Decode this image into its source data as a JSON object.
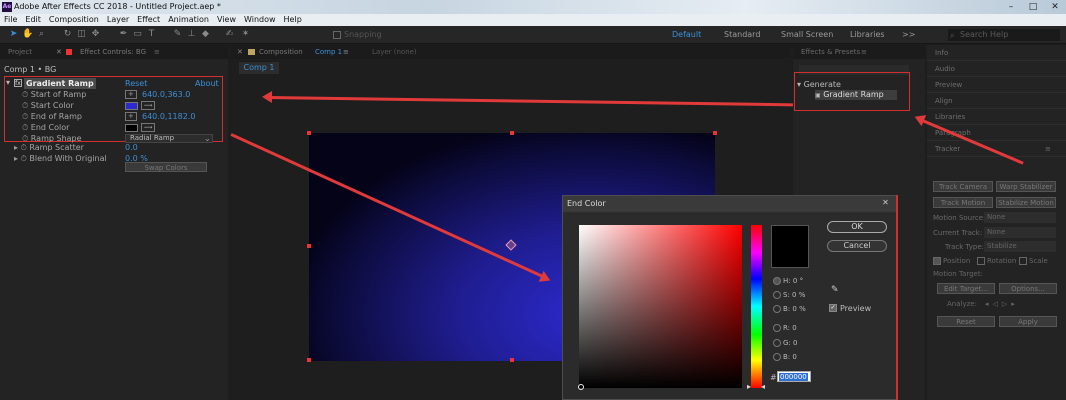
{
  "window": {
    "title": "Adobe After Effects CC 2018 - Untitled Project.aep *",
    "logo": "Ae"
  },
  "menu": [
    "File",
    "Edit",
    "Composition",
    "Layer",
    "Effect",
    "Animation",
    "View",
    "Window",
    "Help"
  ],
  "toolbar": {
    "snapping": "Snapping",
    "workspaces": [
      "Default",
      "Standard",
      "Small Screen",
      "Libraries"
    ],
    "active_workspace": "Default",
    "more": ">>",
    "search_placeholder": "Search Help"
  },
  "project_tab": "Project",
  "effect_controls": {
    "tab": "Effect Controls: BG",
    "breadcrumb": "Comp 1 • BG",
    "effect_name": "Gradient Ramp",
    "fx_badge": "fx",
    "reset": "Reset",
    "about": "About",
    "props": [
      {
        "name": "Start of Ramp",
        "value": "640.0,363.0"
      },
      {
        "name": "Start Color",
        "value": ""
      },
      {
        "name": "End of Ramp",
        "value": "640.0,1182.0"
      },
      {
        "name": "End Color",
        "value": ""
      },
      {
        "name": "Ramp Shape",
        "value": "Radial Ramp"
      },
      {
        "name": "Ramp Scatter",
        "value": "0.0"
      },
      {
        "name": "Blend With Original",
        "value": "0.0 %"
      }
    ],
    "swap_button": "Swap Colors"
  },
  "composition": {
    "tab": "Composition Comp 1",
    "tab_prefix": "Composition",
    "tab_comp": "Comp 1",
    "layer_tab": "Layer (none)",
    "comp_tab": "Comp 1"
  },
  "effects_presets": {
    "tab": "Effects & Presets",
    "category": "Generate",
    "item": "Gradient Ramp"
  },
  "right_panels": [
    "Info",
    "Audio",
    "Preview",
    "Align",
    "Libraries",
    "Paragraph",
    "Tracker"
  ],
  "tracker": {
    "buttons": [
      "Track Camera",
      "Warp Stabilizer",
      "Track Motion",
      "Stabilize Motion"
    ],
    "fields": [
      {
        "label": "Motion Source:",
        "value": "None"
      },
      {
        "label": "Current Track:",
        "value": "None"
      },
      {
        "label": "Track Type:",
        "value": "Stabilize"
      }
    ],
    "checks": [
      "Position",
      "Rotation",
      "Scale"
    ],
    "motion_target": "Motion Target:",
    "edit_target": "Edit Target...",
    "options": "Options...",
    "analyze": "Analyze:",
    "reset": "Reset",
    "apply": "Apply"
  },
  "color_dialog": {
    "title": "End Color",
    "ok": "OK",
    "cancel": "Cancel",
    "preview": "Preview",
    "fields": [
      {
        "label": "H:",
        "value": "0",
        "unit": "°"
      },
      {
        "label": "S:",
        "value": "0",
        "unit": "%"
      },
      {
        "label": "B:",
        "value": "0",
        "unit": "%"
      },
      {
        "label": "R:",
        "value": "0",
        "unit": ""
      },
      {
        "label": "G:",
        "value": "0",
        "unit": ""
      },
      {
        "label": "B:",
        "value": "0",
        "unit": ""
      }
    ],
    "hex_prefix": "#",
    "hex": "000000"
  },
  "colors": {
    "accent": "#3b8fd9",
    "annotation": "#e23a3a",
    "start_color": "#2c2ad0",
    "end_color": "#000000"
  }
}
